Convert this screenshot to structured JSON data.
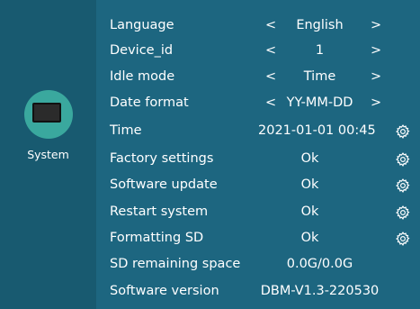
{
  "sidebar": {
    "system_label": "System",
    "icon": "monitor-icon",
    "accent_color": "#3aa89e"
  },
  "settings": {
    "language": {
      "label": "Language",
      "value": "English",
      "prev": "<",
      "next": ">"
    },
    "device_id": {
      "label": "Device_id",
      "value": "1",
      "prev": "<",
      "next": ">"
    },
    "idle_mode": {
      "label": "Idle mode",
      "value": "Time",
      "prev": "<",
      "next": ">"
    },
    "date_format": {
      "label": "Date format",
      "value": "YY-MM-DD",
      "prev": "<",
      "next": ">"
    },
    "time": {
      "label": "Time",
      "value": "2021-01-01  00:45",
      "icon": "gear-icon"
    },
    "factory_settings": {
      "label": "Factory settings",
      "value": "Ok",
      "icon": "gear-icon"
    },
    "software_update": {
      "label": "Software update",
      "value": "Ok",
      "icon": "gear-icon"
    },
    "restart_system": {
      "label": "Restart system",
      "value": "Ok",
      "icon": "gear-icon"
    },
    "formatting_sd": {
      "label": "Formatting SD",
      "value": "Ok",
      "icon": "gear-icon"
    },
    "sd_remaining_space": {
      "label": "SD remaining space",
      "value": "0.0G/0.0G"
    },
    "software_version": {
      "label": "Software version",
      "value": "DBM-V1.3-220530"
    }
  },
  "colors": {
    "background": "#1d6680",
    "sidebar": "#185a70",
    "text": "#ffffff"
  }
}
